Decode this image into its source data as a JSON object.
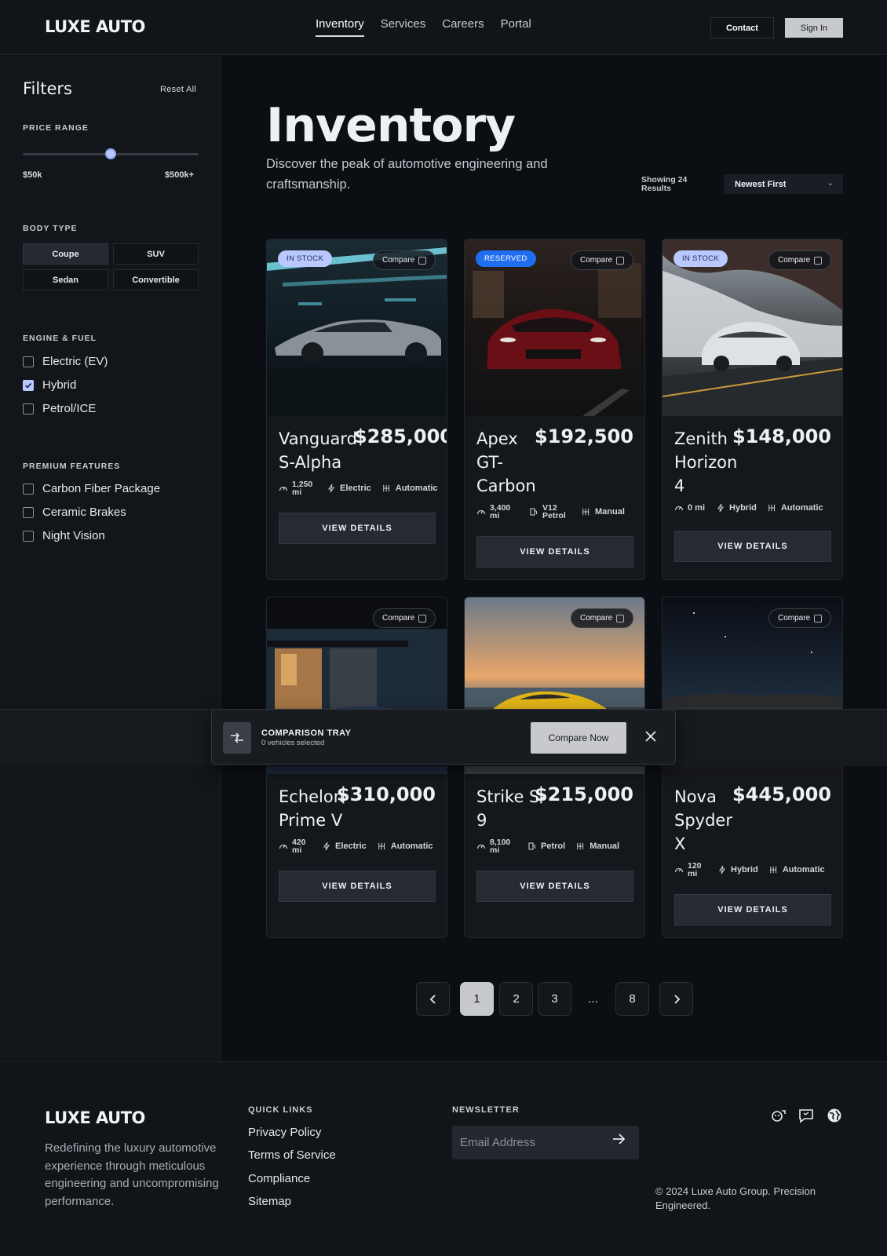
{
  "nav": {
    "logo": "LUXE AUTO",
    "links": [
      "Inventory",
      "Services",
      "Careers",
      "Portal"
    ],
    "contact": "Contact",
    "sign_in": "Sign In"
  },
  "sidebar": {
    "title": "Filters",
    "reset": "Reset All",
    "price_label": "PRICE RANGE",
    "price_min": "$50k",
    "price_max": "$500k+",
    "price_slider_fraction": 0.5,
    "body_label": "BODY TYPE",
    "body_types": [
      "Coupe",
      "SUV",
      "Sedan",
      "Convertible"
    ],
    "body_selected": "Coupe",
    "engine_label": "ENGINE & FUEL",
    "engine": [
      {
        "label": "Electric (EV)",
        "checked": false
      },
      {
        "label": "Hybrid",
        "checked": true
      },
      {
        "label": "Petrol/ICE",
        "checked": false
      }
    ],
    "features_label": "PREMIUM FEATURES",
    "features": [
      {
        "label": "Carbon Fiber Package",
        "checked": false
      },
      {
        "label": "Ceramic Brakes",
        "checked": false
      },
      {
        "label": "Night Vision",
        "checked": false
      }
    ]
  },
  "main": {
    "title": "Inventory",
    "subtitle": "Discover the peak of automotive engineering and craftsmanship.",
    "showing": "Showing 24 Results",
    "sort": "Newest First"
  },
  "cards": [
    {
      "name": "Vanguard S-Alpha",
      "price": "$285,000",
      "badge": "IN STOCK",
      "badge_type": "stock",
      "compare": "Compare",
      "mileage": "1,250 mi",
      "fuel": "Electric",
      "trans": "Automatic",
      "cta": "VIEW DETAILS"
    },
    {
      "name": "Apex GT-Carbon",
      "price": "$192,500",
      "badge": "RESERVED",
      "badge_type": "reserved",
      "compare": "Compare",
      "mileage": "3,400 mi",
      "fuel": "V12 Petrol",
      "trans": "Manual",
      "cta": "VIEW DETAILS"
    },
    {
      "name": "Zenith Horizon 4",
      "price": "$148,000",
      "badge": "IN STOCK",
      "badge_type": "stock",
      "compare": "Compare",
      "mileage": "0 mi",
      "fuel": "Hybrid",
      "trans": "Automatic",
      "cta": "VIEW DETAILS"
    },
    {
      "name": "Echelon Prime V",
      "price": "$310,000",
      "badge": "",
      "badge_type": "",
      "compare": "Compare",
      "mileage": "420 mi",
      "fuel": "Electric",
      "trans": "Automatic",
      "cta": "VIEW DETAILS"
    },
    {
      "name": "Strike S-9",
      "price": "$215,000",
      "badge": "",
      "badge_type": "",
      "compare": "Compare",
      "mileage": "8,100 mi",
      "fuel": "Petrol",
      "trans": "Manual",
      "cta": "VIEW DETAILS"
    },
    {
      "name": "Nova Spyder X",
      "price": "$445,000",
      "badge": "",
      "badge_type": "",
      "compare": "Compare",
      "mileage": "120 mi",
      "fuel": "Hybrid",
      "trans": "Automatic",
      "cta": "VIEW DETAILS"
    }
  ],
  "tray": {
    "title": "COMPARISON TRAY",
    "subtitle": "0 vehicles selected",
    "button": "Compare Now"
  },
  "pagination": {
    "pages": [
      "1",
      "2",
      "3",
      "...",
      "8"
    ],
    "current": "1"
  },
  "footer": {
    "logo": "LUXE AUTO",
    "description": "Redefining the luxury automotive experience through meticulous engineering and uncompromising performance.",
    "quick_links_label": "QUICK LINKS",
    "quick_links": [
      "Privacy Policy",
      "Terms of Service",
      "Compliance",
      "Sitemap"
    ],
    "newsletter_label": "NEWSLETTER",
    "email_placeholder": "Email Address",
    "copyright": "© 2024 Luxe Auto Group. Precision Engineered."
  }
}
